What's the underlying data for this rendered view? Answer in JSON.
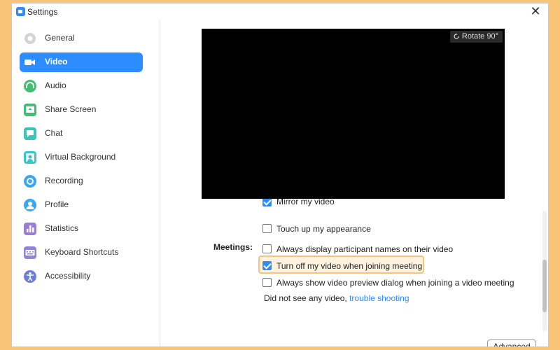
{
  "window": {
    "title": "Settings",
    "close_icon": "close-icon"
  },
  "sidebar": {
    "items": [
      {
        "label": "General",
        "icon": "gear-icon",
        "color": "#cfcfcf",
        "active": false
      },
      {
        "label": "Video",
        "icon": "video-camera-icon",
        "color": "#ffffff",
        "active": true
      },
      {
        "label": "Audio",
        "icon": "headphones-icon",
        "color": "#3fbf6f",
        "active": false
      },
      {
        "label": "Share Screen",
        "icon": "share-screen-icon",
        "color": "#3fbf6f",
        "active": false
      },
      {
        "label": "Chat",
        "icon": "chat-bubble-icon",
        "color": "#39c6b7",
        "active": false
      },
      {
        "label": "Virtual Background",
        "icon": "person-background-icon",
        "color": "#39c6c6",
        "active": false
      },
      {
        "label": "Recording",
        "icon": "record-icon",
        "color": "#3aa7f0",
        "active": false
      },
      {
        "label": "Profile",
        "icon": "user-icon",
        "color": "#3aa7f0",
        "active": false
      },
      {
        "label": "Statistics",
        "icon": "bar-chart-icon",
        "color": "#9b7fd6",
        "active": false
      },
      {
        "label": "Keyboard Shortcuts",
        "icon": "keyboard-icon",
        "color": "#8f86d9",
        "active": false
      },
      {
        "label": "Accessibility",
        "icon": "accessibility-icon",
        "color": "#6c7fd6",
        "active": false
      }
    ]
  },
  "preview": {
    "rotate_label": "Rotate 90°"
  },
  "options": {
    "mirror_video": "Mirror my video",
    "mirror_checked": true,
    "touch_up": "Touch up my appearance",
    "touch_up_checked": false,
    "meetings_label": "Meetings:",
    "display_names": "Always display participant names on their video",
    "display_names_checked": false,
    "turn_off_video": "Turn off my video when joining meeting",
    "turn_off_checked": true,
    "preview_dialog": "Always show video preview dialog when joining a video meeting",
    "preview_dialog_checked": false,
    "no_video_text": "Did not see any video,",
    "troubleshoot_link": "trouble shooting"
  },
  "buttons": {
    "advanced": "Advanced"
  },
  "colors": {
    "accent": "#2d8cff",
    "highlight_border": "#f8c477",
    "background": "#f8c477"
  }
}
